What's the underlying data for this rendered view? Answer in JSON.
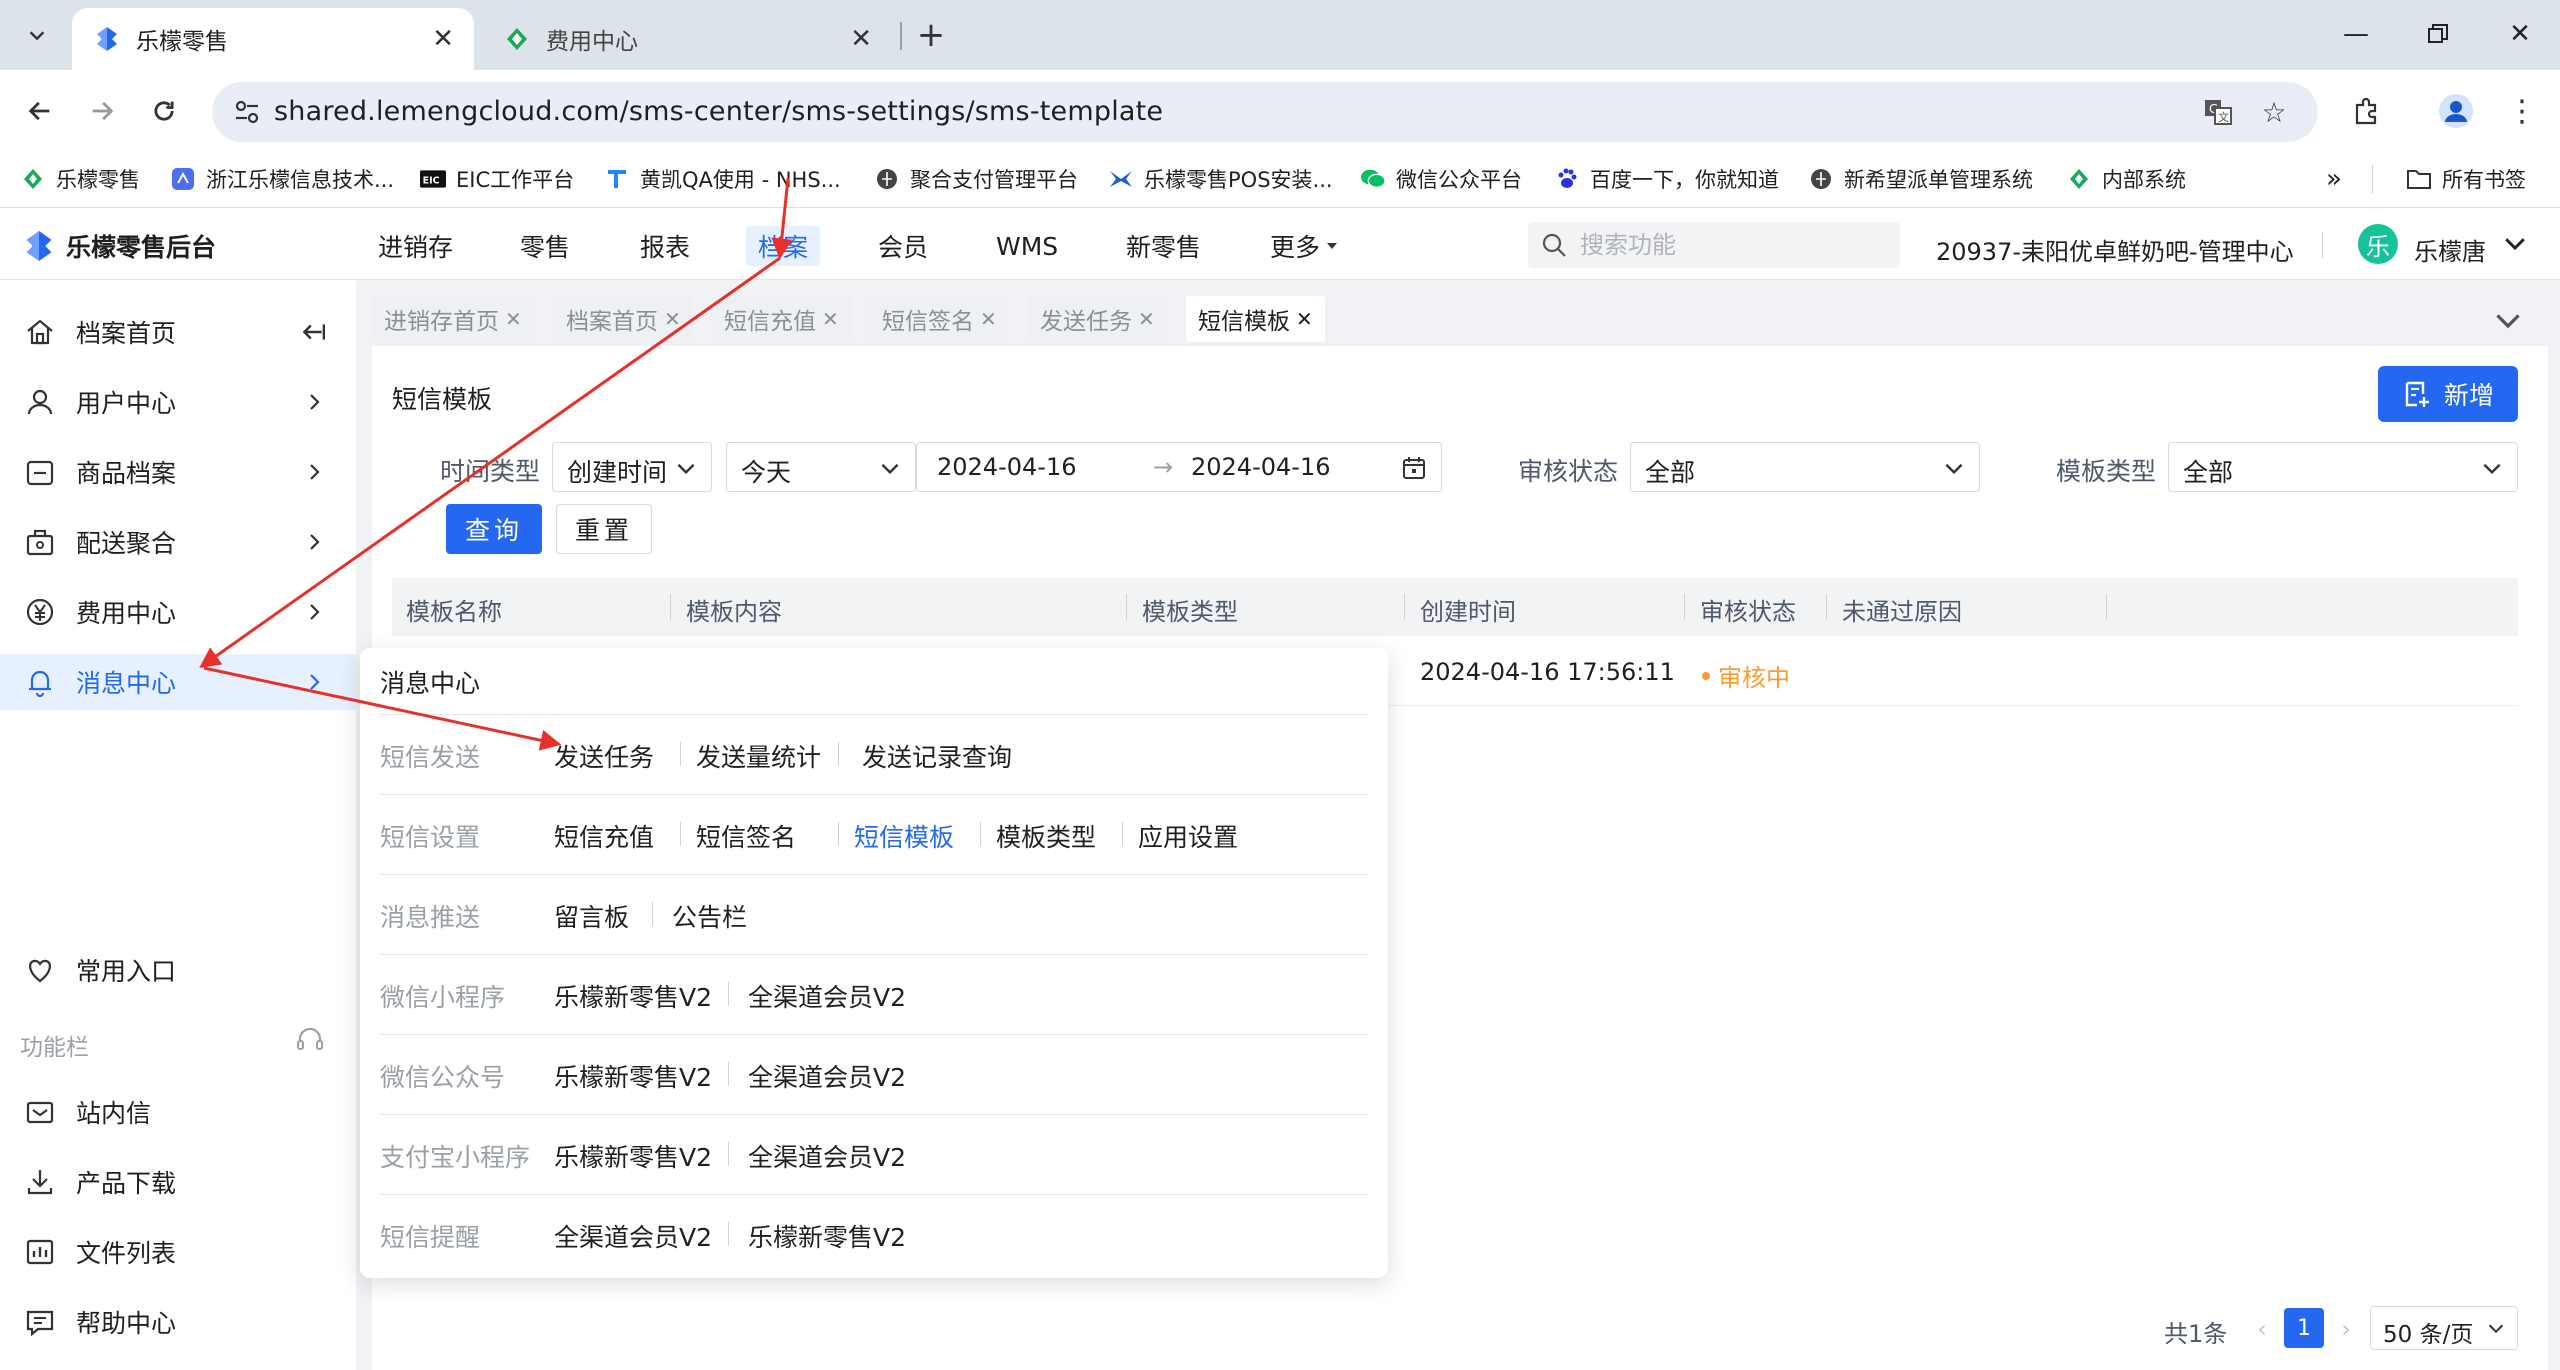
{
  "browser": {
    "tabs": [
      {
        "title": "乐檬零售",
        "active": true
      },
      {
        "title": "费用中心",
        "active": false
      }
    ],
    "url": "shared.lemengcloud.com/sms-center/sms-settings/sms-template",
    "bookmarks": [
      "乐檬零售",
      "浙江乐檬信息技术...",
      "EIC工作平台",
      "黄凯QA使用 - NHS...",
      "聚合支付管理平台",
      "乐檬零售POS安装...",
      "微信公众平台",
      "百度一下，你就知道",
      "新希望派单管理系统",
      "内部系统"
    ],
    "all_bookmarks": "所有书签"
  },
  "header": {
    "brand": "乐檬零售后台",
    "nav": [
      "进销存",
      "零售",
      "报表",
      "档案",
      "会员",
      "WMS",
      "新零售",
      "更多"
    ],
    "active_nav": "档案",
    "search_placeholder": "搜索功能",
    "store": "20937-耒阳优卓鲜奶吧-管理中心",
    "avatar_char": "乐",
    "user": "乐檬唐"
  },
  "sidebar": {
    "items": [
      "档案首页",
      "用户中心",
      "商品档案",
      "配送聚合",
      "费用中心",
      "消息中心"
    ],
    "active": "消息中心",
    "common_entry": "常用入口",
    "section": "功能栏",
    "tools": [
      "站内信",
      "产品下载",
      "文件列表",
      "帮助中心"
    ]
  },
  "tags": [
    {
      "label": "进销存首页",
      "active": false
    },
    {
      "label": "档案首页",
      "active": false
    },
    {
      "label": "短信充值",
      "active": false
    },
    {
      "label": "短信签名",
      "active": false
    },
    {
      "label": "发送任务",
      "active": false
    },
    {
      "label": "短信模板",
      "active": true
    }
  ],
  "page": {
    "title": "短信模板",
    "add_button": "新增",
    "filters": {
      "time_type_label": "时间类型",
      "time_type_value": "创建时间",
      "period_value": "今天",
      "date_start": "2024-04-16",
      "date_end": "2024-04-16",
      "audit_label": "审核状态",
      "audit_value": "全部",
      "template_type_label": "模板类型",
      "template_type_value": "全部"
    },
    "query_button": "查询",
    "reset_button": "重置",
    "table": {
      "columns": [
        "模板名称",
        "模板内容",
        "模板类型",
        "创建时间",
        "审核状态",
        "未通过原因"
      ],
      "rows": [
        {
          "created": "2024-04-16 17:56:11",
          "status": "审核中"
        }
      ]
    },
    "pagination": {
      "total": "共1条",
      "page": "1",
      "page_size": "50 条/页"
    }
  },
  "flyout": {
    "title": "消息中心",
    "groups": [
      {
        "category": "短信发送",
        "links": [
          "发送任务",
          "发送量统计",
          "发送记录查询"
        ]
      },
      {
        "category": "短信设置",
        "links": [
          "短信充值",
          "短信签名",
          "短信模板",
          "模板类型",
          "应用设置"
        ]
      },
      {
        "category": "消息推送",
        "links": [
          "留言板",
          "公告栏"
        ]
      },
      {
        "category": "微信小程序",
        "links": [
          "乐檬新零售V2",
          "全渠道会员V2"
        ]
      },
      {
        "category": "微信公众号",
        "links": [
          "乐檬新零售V2",
          "全渠道会员V2"
        ]
      },
      {
        "category": "支付宝小程序",
        "links": [
          "乐檬新零售V2",
          "全渠道会员V2"
        ]
      },
      {
        "category": "短信提醒",
        "links": [
          "全渠道会员V2",
          "乐檬新零售V2"
        ]
      }
    ],
    "active_link": "短信模板"
  },
  "colors": {
    "primary": "#2468f2",
    "warning": "#ff9a2e",
    "annotation": "#e8302a"
  }
}
